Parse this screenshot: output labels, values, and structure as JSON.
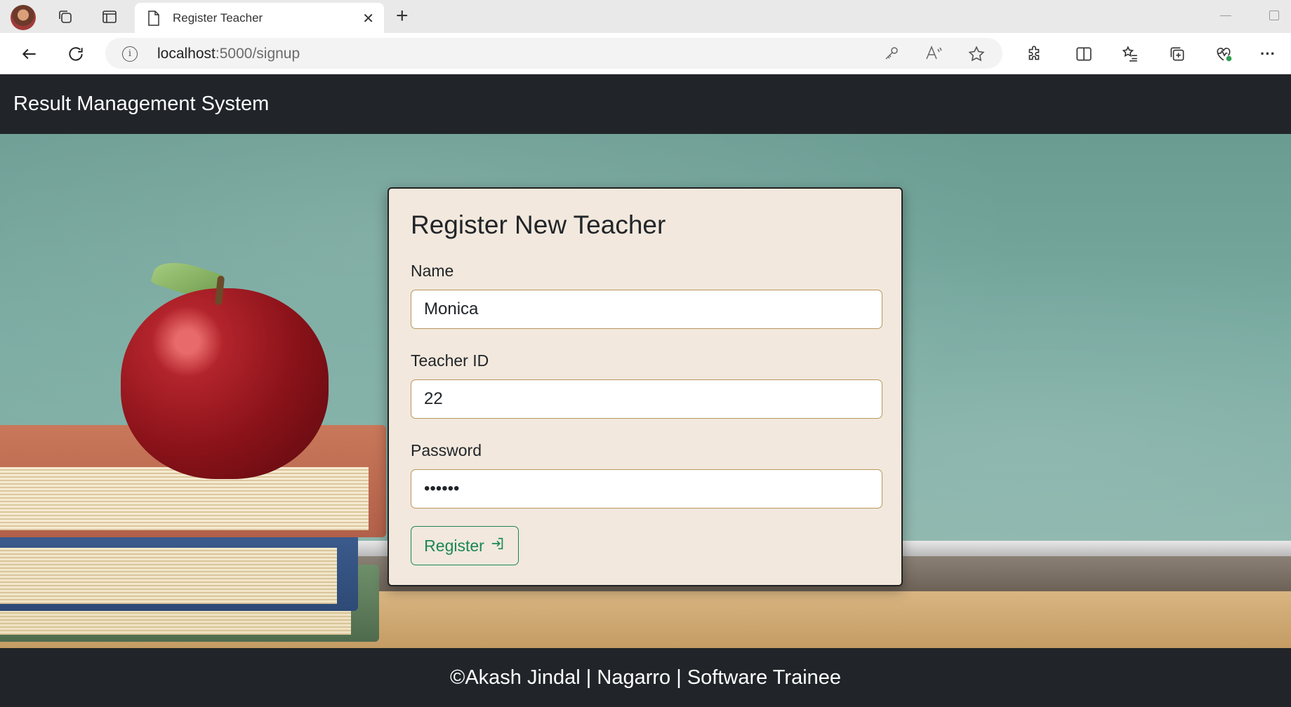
{
  "browser": {
    "tab_title": "Register Teacher",
    "url_host": "localhost",
    "url_path": ":5000/signup",
    "icons": [
      "profile-avatar",
      "workspaces-icon",
      "tab-actions-icon",
      "page-icon",
      "close-icon",
      "new-tab-icon",
      "back-icon",
      "refresh-icon",
      "site-info-icon",
      "key-icon",
      "read-aloud-icon",
      "favorite-star-icon",
      "extensions-icon",
      "split-screen-icon",
      "favorites-icon",
      "collections-icon",
      "browser-essentials-icon",
      "more-icon"
    ]
  },
  "app": {
    "brand": "Result Management System"
  },
  "form": {
    "title": "Register New Teacher",
    "name_label": "Name",
    "name_value": "Monica",
    "teacher_id_label": "Teacher ID",
    "teacher_id_value": "22",
    "password_label": "Password",
    "password_value": "••••••",
    "register_label": "Register",
    "accent_color": "#198754"
  },
  "footer": {
    "text": "©Akash Jindal | Nagarro | Software Trainee"
  }
}
